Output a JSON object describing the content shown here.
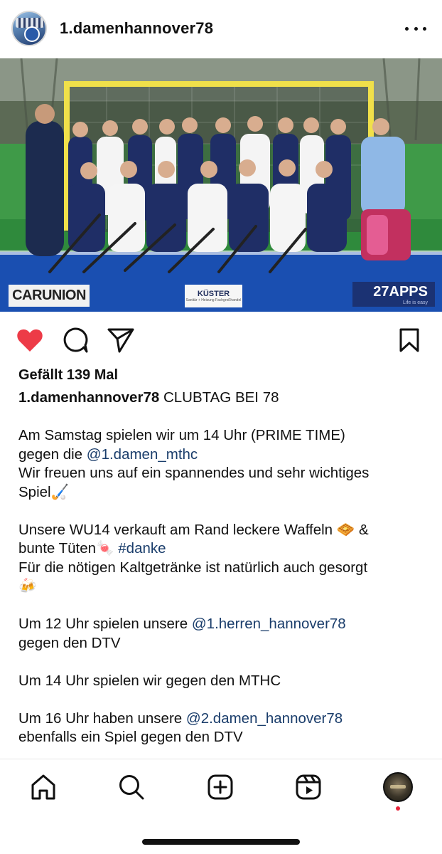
{
  "header": {
    "username": "1.damenhannover78"
  },
  "post": {
    "photo_sponsors": {
      "carunion": "CARUNION",
      "kuester": "KÜSTER",
      "kuester_sub": "Sanitär + Heizung Fachgroßhandel",
      "apps": "27APPS",
      "apps_sub": "Life is easy"
    },
    "liked": true,
    "likes_text": "Gefällt 139 Mal",
    "caption": {
      "username": "1.damenhannover78",
      "title": "CLUBTAG BEI 78",
      "line_1": "Am Samstag spielen wir um 14 Uhr (PRIME TIME)",
      "line_2_prefix": "gegen die",
      "mention_mthc": "@1.damen_mthc",
      "line_3": "Wir freuen uns auf ein spannendes und sehr wichtiges",
      "line_4": "Spiel🏑",
      "line_5": "Unsere WU14 verkauft am Rand leckere Waffeln 🧇 &",
      "line_6_prefix": "bunte Tüten🍬",
      "hashtag_danke": "#danke",
      "line_7": "Für die nötigen Kaltgetränke ist natürlich auch gesorgt",
      "line_8": "🍻",
      "line_9_prefix": "Um 12 Uhr spielen unsere",
      "mention_herren": "@1.herren_hannover78",
      "line_10": "gegen den DTV",
      "line_11": "Um 14 Uhr spielen wir gegen den MTHC",
      "line_12_prefix": "Um 16 Uhr haben unsere",
      "mention_damen2": "@2.damen_hannover78",
      "line_13": "ebenfalls ein Spiel gegen den DTV"
    }
  },
  "icons": {
    "like": "heart-filled-icon",
    "comment": "comment-icon",
    "share": "send-icon",
    "save": "bookmark-icon",
    "more": "more-horizontal-icon"
  },
  "bottom_nav": {
    "items": [
      "home",
      "search",
      "create",
      "reels",
      "profile"
    ],
    "notification_dot": true
  },
  "colors": {
    "heart": "#ed3b47",
    "link": "#1a3d6b",
    "notification": "#e8233a"
  }
}
